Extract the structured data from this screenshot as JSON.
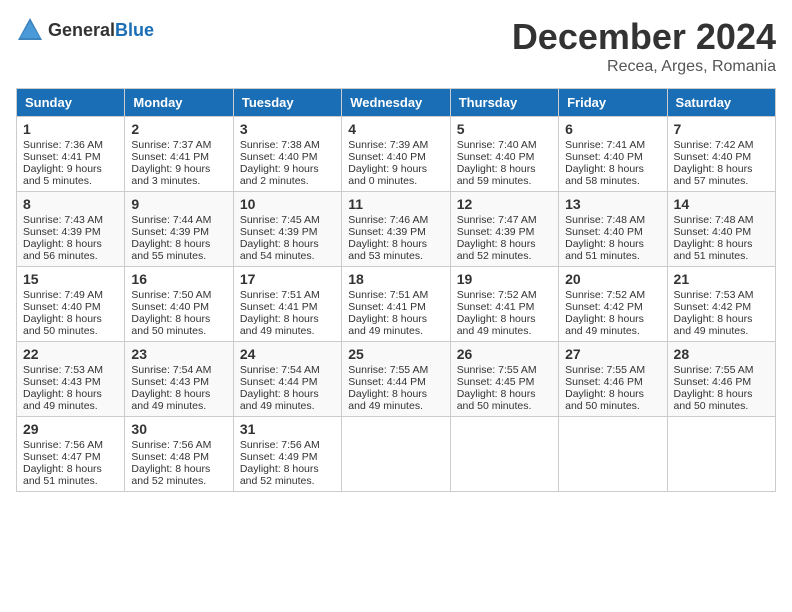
{
  "header": {
    "logo_general": "General",
    "logo_blue": "Blue",
    "month_title": "December 2024",
    "subtitle": "Recea, Arges, Romania"
  },
  "days_of_week": [
    "Sunday",
    "Monday",
    "Tuesday",
    "Wednesday",
    "Thursday",
    "Friday",
    "Saturday"
  ],
  "weeks": [
    [
      {
        "day": 1,
        "sunrise": "7:36 AM",
        "sunset": "4:41 PM",
        "daylight": "9 hours and 5 minutes."
      },
      {
        "day": 2,
        "sunrise": "7:37 AM",
        "sunset": "4:41 PM",
        "daylight": "9 hours and 3 minutes."
      },
      {
        "day": 3,
        "sunrise": "7:38 AM",
        "sunset": "4:40 PM",
        "daylight": "9 hours and 2 minutes."
      },
      {
        "day": 4,
        "sunrise": "7:39 AM",
        "sunset": "4:40 PM",
        "daylight": "9 hours and 0 minutes."
      },
      {
        "day": 5,
        "sunrise": "7:40 AM",
        "sunset": "4:40 PM",
        "daylight": "8 hours and 59 minutes."
      },
      {
        "day": 6,
        "sunrise": "7:41 AM",
        "sunset": "4:40 PM",
        "daylight": "8 hours and 58 minutes."
      },
      {
        "day": 7,
        "sunrise": "7:42 AM",
        "sunset": "4:40 PM",
        "daylight": "8 hours and 57 minutes."
      }
    ],
    [
      {
        "day": 8,
        "sunrise": "7:43 AM",
        "sunset": "4:39 PM",
        "daylight": "8 hours and 56 minutes."
      },
      {
        "day": 9,
        "sunrise": "7:44 AM",
        "sunset": "4:39 PM",
        "daylight": "8 hours and 55 minutes."
      },
      {
        "day": 10,
        "sunrise": "7:45 AM",
        "sunset": "4:39 PM",
        "daylight": "8 hours and 54 minutes."
      },
      {
        "day": 11,
        "sunrise": "7:46 AM",
        "sunset": "4:39 PM",
        "daylight": "8 hours and 53 minutes."
      },
      {
        "day": 12,
        "sunrise": "7:47 AM",
        "sunset": "4:39 PM",
        "daylight": "8 hours and 52 minutes."
      },
      {
        "day": 13,
        "sunrise": "7:48 AM",
        "sunset": "4:40 PM",
        "daylight": "8 hours and 51 minutes."
      },
      {
        "day": 14,
        "sunrise": "7:48 AM",
        "sunset": "4:40 PM",
        "daylight": "8 hours and 51 minutes."
      }
    ],
    [
      {
        "day": 15,
        "sunrise": "7:49 AM",
        "sunset": "4:40 PM",
        "daylight": "8 hours and 50 minutes."
      },
      {
        "day": 16,
        "sunrise": "7:50 AM",
        "sunset": "4:40 PM",
        "daylight": "8 hours and 50 minutes."
      },
      {
        "day": 17,
        "sunrise": "7:51 AM",
        "sunset": "4:41 PM",
        "daylight": "8 hours and 49 minutes."
      },
      {
        "day": 18,
        "sunrise": "7:51 AM",
        "sunset": "4:41 PM",
        "daylight": "8 hours and 49 minutes."
      },
      {
        "day": 19,
        "sunrise": "7:52 AM",
        "sunset": "4:41 PM",
        "daylight": "8 hours and 49 minutes."
      },
      {
        "day": 20,
        "sunrise": "7:52 AM",
        "sunset": "4:42 PM",
        "daylight": "8 hours and 49 minutes."
      },
      {
        "day": 21,
        "sunrise": "7:53 AM",
        "sunset": "4:42 PM",
        "daylight": "8 hours and 49 minutes."
      }
    ],
    [
      {
        "day": 22,
        "sunrise": "7:53 AM",
        "sunset": "4:43 PM",
        "daylight": "8 hours and 49 minutes."
      },
      {
        "day": 23,
        "sunrise": "7:54 AM",
        "sunset": "4:43 PM",
        "daylight": "8 hours and 49 minutes."
      },
      {
        "day": 24,
        "sunrise": "7:54 AM",
        "sunset": "4:44 PM",
        "daylight": "8 hours and 49 minutes."
      },
      {
        "day": 25,
        "sunrise": "7:55 AM",
        "sunset": "4:44 PM",
        "daylight": "8 hours and 49 minutes."
      },
      {
        "day": 26,
        "sunrise": "7:55 AM",
        "sunset": "4:45 PM",
        "daylight": "8 hours and 50 minutes."
      },
      {
        "day": 27,
        "sunrise": "7:55 AM",
        "sunset": "4:46 PM",
        "daylight": "8 hours and 50 minutes."
      },
      {
        "day": 28,
        "sunrise": "7:55 AM",
        "sunset": "4:46 PM",
        "daylight": "8 hours and 50 minutes."
      }
    ],
    [
      {
        "day": 29,
        "sunrise": "7:56 AM",
        "sunset": "4:47 PM",
        "daylight": "8 hours and 51 minutes."
      },
      {
        "day": 30,
        "sunrise": "7:56 AM",
        "sunset": "4:48 PM",
        "daylight": "8 hours and 52 minutes."
      },
      {
        "day": 31,
        "sunrise": "7:56 AM",
        "sunset": "4:49 PM",
        "daylight": "8 hours and 52 minutes."
      },
      null,
      null,
      null,
      null
    ]
  ]
}
